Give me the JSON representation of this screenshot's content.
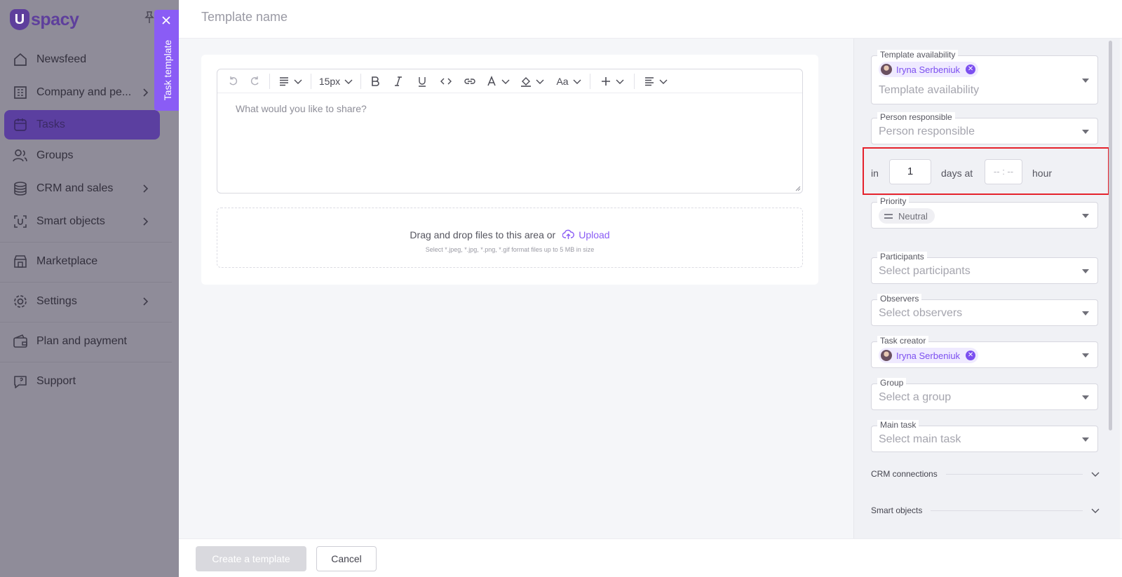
{
  "app": {
    "logo_letter": "U",
    "logo_text": "spacy"
  },
  "sidebar": {
    "items": [
      {
        "label": "Newsfeed",
        "icon": "home-icon"
      },
      {
        "label": "Company and pe...",
        "icon": "building-icon"
      },
      {
        "label": "Tasks",
        "icon": "calendar-icon"
      },
      {
        "label": "Groups",
        "icon": "users-icon"
      },
      {
        "label": "CRM and sales",
        "icon": "coins-icon"
      },
      {
        "label": "Smart objects",
        "icon": "smart-object-icon"
      },
      {
        "label": "Marketplace",
        "icon": "store-icon"
      },
      {
        "label": "Settings",
        "icon": "gear-icon"
      },
      {
        "label": "Plan and payment",
        "icon": "wallet-icon"
      },
      {
        "label": "Support",
        "icon": "chat-icon"
      }
    ]
  },
  "side_tab": {
    "label": "Task template"
  },
  "header": {
    "title_placeholder": "Template name"
  },
  "editor": {
    "font_size": "15px",
    "font_case": "Aa",
    "placeholder": "What would you like to share?"
  },
  "dropzone": {
    "text": "Drag and drop files to this area or",
    "upload_label": "Upload",
    "hint": "Select *.jpeg, *.jpg, *.png, *.gif format files up to 5 MB in size"
  },
  "form": {
    "availability": {
      "label": "Template availability",
      "chip": "Iryna Serbeniuk",
      "placeholder": "Template availability"
    },
    "responsible": {
      "label": "Person responsible",
      "placeholder": "Person responsible"
    },
    "deadline": {
      "prefix": "in",
      "days": "1",
      "days_label": "days at",
      "time_placeholder": "-- : --",
      "suffix": "hour"
    },
    "priority": {
      "label": "Priority",
      "value": "Neutral"
    },
    "participants": {
      "label": "Participants",
      "placeholder": "Select participants"
    },
    "observers": {
      "label": "Observers",
      "placeholder": "Select observers"
    },
    "creator": {
      "label": "Task creator",
      "chip": "Iryna Serbeniuk"
    },
    "group": {
      "label": "Group",
      "placeholder": "Select a group"
    },
    "main_task": {
      "label": "Main task",
      "placeholder": "Select main task"
    },
    "crm_section": "CRM connections",
    "smart_section": "Smart objects"
  },
  "footer": {
    "create_label": "Create a template",
    "cancel_label": "Cancel"
  },
  "colors": {
    "accent": "#8a5cf5",
    "highlight_border": "#e5222c"
  }
}
